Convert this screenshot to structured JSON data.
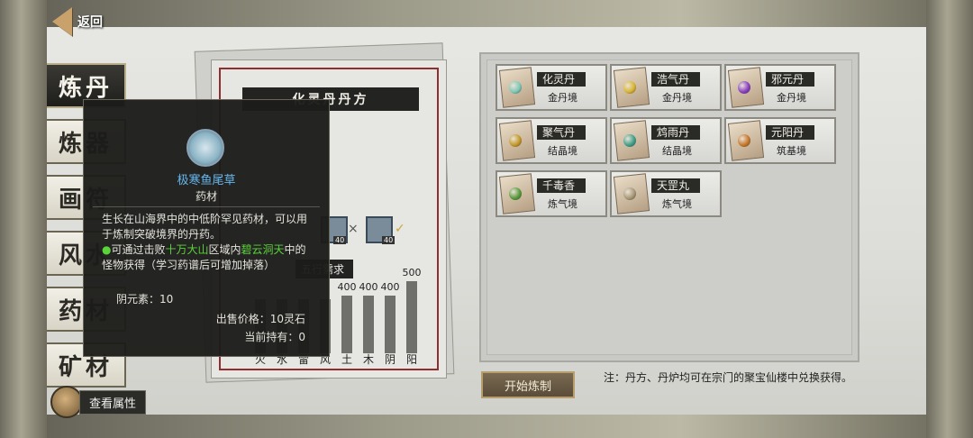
{
  "nav": {
    "back_label": "返回"
  },
  "tabs": [
    {
      "label": "炼丹",
      "active": true
    },
    {
      "label": "炼器"
    },
    {
      "label": "画符"
    },
    {
      "label": "风水"
    },
    {
      "label": "药材"
    },
    {
      "label": "矿材"
    }
  ],
  "recipe": {
    "title": "化灵丹丹方",
    "material_counts": [
      "40",
      "40"
    ],
    "requirement_label": "五行需求",
    "elements": [
      {
        "label": "火",
        "value": ""
      },
      {
        "label": "水",
        "value": ""
      },
      {
        "label": "雷",
        "value": ""
      },
      {
        "label": "风",
        "value": ""
      },
      {
        "label": "土",
        "value": "400"
      },
      {
        "label": "木",
        "value": "400"
      },
      {
        "label": "阴",
        "value": "400"
      },
      {
        "label": "阳",
        "value": "500"
      }
    ]
  },
  "pills": [
    {
      "name": "化灵丹",
      "realm": "金丹境",
      "color": "#7fc9b7"
    },
    {
      "name": "浩气丹",
      "realm": "金丹境",
      "color": "#d9b634"
    },
    {
      "name": "邪元丹",
      "realm": "金丹境",
      "color": "#8a3fc2"
    },
    {
      "name": "聚气丹",
      "realm": "结晶境",
      "color": "#c59a2a"
    },
    {
      "name": "鸩雨丹",
      "realm": "结晶境",
      "color": "#3fa08a"
    },
    {
      "name": "元阳丹",
      "realm": "筑基境",
      "color": "#c8782c"
    },
    {
      "name": "千毒香",
      "realm": "炼气境",
      "color": "#5a9a3c"
    },
    {
      "name": "天罡丸",
      "realm": "炼气境",
      "color": "#a89a78"
    }
  ],
  "actions": {
    "start_label": "开始炼制",
    "attr_label": "查看属性"
  },
  "note": "注：丹方、丹炉均可在宗门的聚宝仙楼中兑换获得。",
  "tooltip": {
    "name": "极寒鱼尾草",
    "type": "药材",
    "desc": "生长在山海界中的中低阶罕见药材，可以用于炼制突破境界的丹药。",
    "src_prefix": "可通过击败",
    "src_place1": "十万大山",
    "src_mid": "区域内",
    "src_place2": "碧云洞天",
    "src_suffix": "中的怪物获得（学习药谱后可增加掉落）",
    "yin": "阴元素：10",
    "price": "出售价格：10灵石",
    "hold": "当前持有：0"
  }
}
